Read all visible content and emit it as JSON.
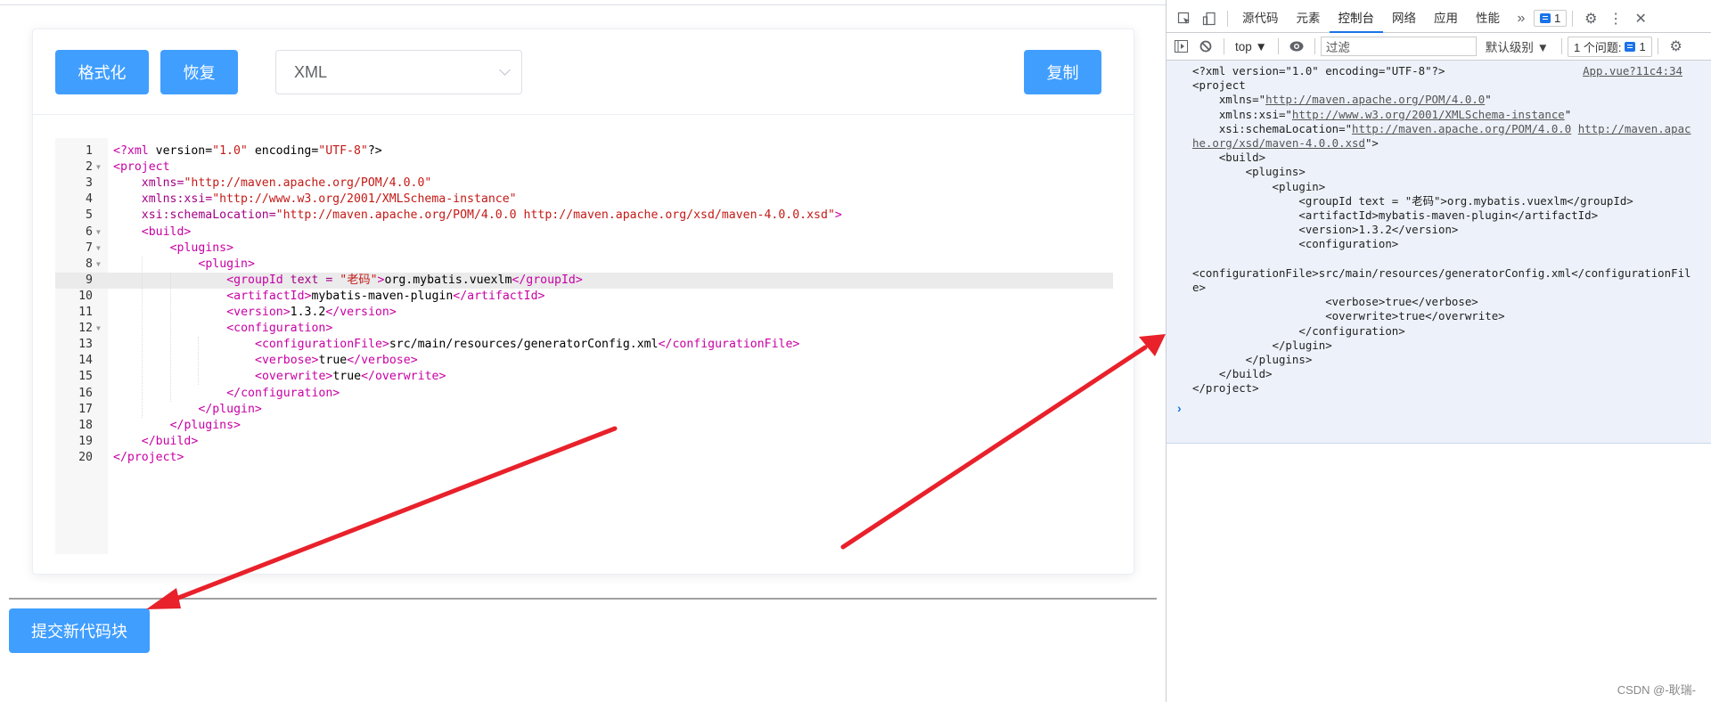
{
  "app": {
    "toolbar": {
      "format_label": "格式化",
      "restore_label": "恢复",
      "language_select": "XML",
      "copy_label": "复制"
    },
    "editor": {
      "active_line": 9,
      "lines": [
        {
          "n": "1",
          "fold": false,
          "indent": 0,
          "parts": [
            [
              "t",
              "<?xml"
            ],
            [
              "c",
              " version="
            ],
            [
              "s",
              "\"1.0\""
            ],
            [
              "c",
              " encoding="
            ],
            [
              "s",
              "\"UTF-8\""
            ],
            [
              "c",
              "?>"
            ]
          ]
        },
        {
          "n": "2",
          "fold": true,
          "indent": 0,
          "parts": [
            [
              "t",
              "<project"
            ]
          ]
        },
        {
          "n": "3",
          "fold": false,
          "indent": 1,
          "parts": [
            [
              "a",
              "xmlns="
            ],
            [
              "s",
              "\"http://maven.apache.org/POM/4.0.0\""
            ]
          ]
        },
        {
          "n": "4",
          "fold": false,
          "indent": 1,
          "parts": [
            [
              "a",
              "xmlns:xsi="
            ],
            [
              "s",
              "\"http://www.w3.org/2001/XMLSchema-instance\""
            ]
          ]
        },
        {
          "n": "5",
          "fold": false,
          "indent": 1,
          "parts": [
            [
              "a",
              "xsi:schemaLocation="
            ],
            [
              "s",
              "\"http://maven.apache.org/POM/4.0.0 http://maven.apache.org/xsd/maven-4.0.0.xsd\""
            ],
            [
              "t",
              ">"
            ]
          ]
        },
        {
          "n": "6",
          "fold": true,
          "indent": 1,
          "parts": [
            [
              "t",
              "<build>"
            ]
          ]
        },
        {
          "n": "7",
          "fold": true,
          "indent": 2,
          "parts": [
            [
              "t",
              "<plugins>"
            ]
          ]
        },
        {
          "n": "8",
          "fold": true,
          "indent": 3,
          "parts": [
            [
              "t",
              "<plugin>"
            ]
          ]
        },
        {
          "n": "9",
          "fold": false,
          "indent": 4,
          "parts": [
            [
              "t",
              "<groupId"
            ],
            [
              "a",
              " text = "
            ],
            [
              "s",
              "\"老码\""
            ],
            [
              "t",
              ">"
            ],
            [
              "c",
              "org.mybatis.vuexlm"
            ],
            [
              "t",
              "</groupId>"
            ]
          ]
        },
        {
          "n": "10",
          "fold": false,
          "indent": 4,
          "parts": [
            [
              "t",
              "<artifactId>"
            ],
            [
              "c",
              "mybatis-maven-plugin"
            ],
            [
              "t",
              "</artifactId>"
            ]
          ]
        },
        {
          "n": "11",
          "fold": false,
          "indent": 4,
          "parts": [
            [
              "t",
              "<version>"
            ],
            [
              "c",
              "1.3.2"
            ],
            [
              "t",
              "</version>"
            ]
          ]
        },
        {
          "n": "12",
          "fold": true,
          "indent": 4,
          "parts": [
            [
              "t",
              "<configuration>"
            ]
          ]
        },
        {
          "n": "13",
          "fold": false,
          "indent": 5,
          "parts": [
            [
              "t",
              "<configurationFile>"
            ],
            [
              "c",
              "src/main/resources/generatorConfig.xml"
            ],
            [
              "t",
              "</configurationFile>"
            ]
          ]
        },
        {
          "n": "14",
          "fold": false,
          "indent": 5,
          "parts": [
            [
              "t",
              "<verbose>"
            ],
            [
              "c",
              "true"
            ],
            [
              "t",
              "</verbose>"
            ]
          ]
        },
        {
          "n": "15",
          "fold": false,
          "indent": 5,
          "parts": [
            [
              "t",
              "<overwrite>"
            ],
            [
              "c",
              "true"
            ],
            [
              "t",
              "</overwrite>"
            ]
          ]
        },
        {
          "n": "16",
          "fold": false,
          "indent": 4,
          "parts": [
            [
              "t",
              "</configuration>"
            ]
          ]
        },
        {
          "n": "17",
          "fold": false,
          "indent": 3,
          "parts": [
            [
              "t",
              "</plugin>"
            ]
          ]
        },
        {
          "n": "18",
          "fold": false,
          "indent": 2,
          "parts": [
            [
              "t",
              "</plugins>"
            ]
          ]
        },
        {
          "n": "19",
          "fold": false,
          "indent": 1,
          "parts": [
            [
              "t",
              "</build>"
            ]
          ]
        },
        {
          "n": "20",
          "fold": false,
          "indent": 0,
          "parts": [
            [
              "t",
              "</project>"
            ]
          ]
        }
      ]
    },
    "submit_label": "提交新代码块"
  },
  "devtools": {
    "tabs": [
      "源代码",
      "元素",
      "控制台",
      "网络",
      "应用",
      "性能"
    ],
    "active_tab": "控制台",
    "more_tabs": "»",
    "issues_badge_count": "1",
    "context_select": "top ▼",
    "filter_placeholder": "过滤",
    "level_select": "默认级别 ▼",
    "issues_label": "1 个问题:",
    "issues_count": "1",
    "console": {
      "source_link": "App.vue?11c4:34",
      "lines": [
        "<?xml version=\"1.0\" encoding=\"UTF-8\"?>",
        "<project",
        "    xmlns=\"http://maven.apache.org/POM/4.0.0\"",
        "    xmlns:xsi=\"http://www.w3.org/2001/XMLSchema-instance\"",
        "    xsi:schemaLocation=\"http://maven.apache.org/POM/4.0.0 http://maven.apac",
        "he.org/xsd/maven-4.0.0.xsd\">",
        "    <build>",
        "        <plugins>",
        "            <plugin>",
        "                <groupId text = \"老码\">org.mybatis.vuexlm</groupId>",
        "                <artifactId>mybatis-maven-plugin</artifactId>",
        "                <version>1.3.2</version>",
        "                <configuration>",
        "",
        "<configurationFile>src/main/resources/generatorConfig.xml</configurationFil",
        "e>",
        "                    <verbose>true</verbose>",
        "                    <overwrite>true</overwrite>",
        "                </configuration>",
        "            </plugin>",
        "        </plugins>",
        "    </build>",
        "</project>"
      ],
      "prompt": "›"
    }
  },
  "watermark": "CSDN @-耿瑞-",
  "colors": {
    "primary": "#409eff",
    "annotation_arrow": "#e8212b",
    "devtools_accent": "#1a73e8"
  }
}
